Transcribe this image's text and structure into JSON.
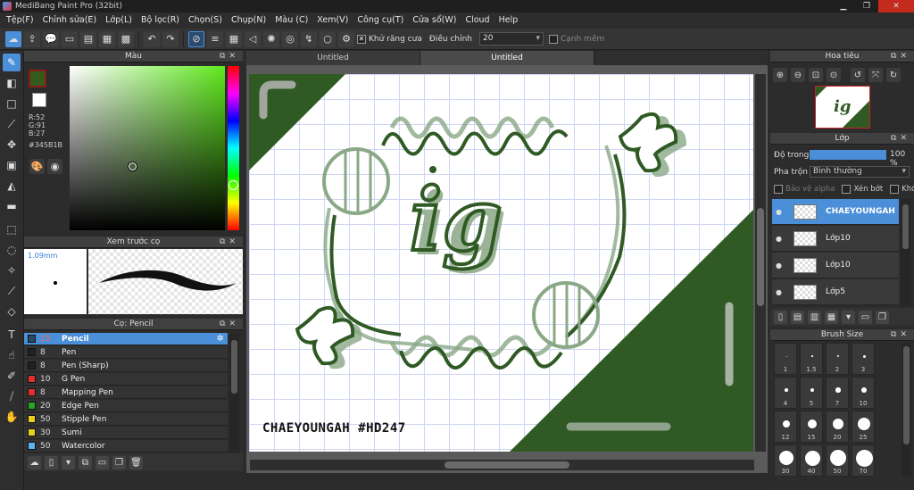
{
  "window": {
    "title": "MediBang Paint Pro (32bit)"
  },
  "menu": [
    "Tệp(F)",
    "Chỉnh sửa(E)",
    "Lớp(L)",
    "Bộ lọc(R)",
    "Chọn(S)",
    "Chụp(N)",
    "Màu (C)",
    "Xem(V)",
    "Công cụ(T)",
    "Cửa sổ(W)",
    "Cloud",
    "Help"
  ],
  "toolbar": {
    "antialias_label": "Khử răng cưa",
    "correction_label": "Điều chỉnh",
    "correction_value": "20",
    "soft_edge_label": "Cạnh mềm"
  },
  "color_panel": {
    "title": "Màu",
    "r": "R:52",
    "g": "G:91",
    "b": "B:27",
    "hex": "#345B1B",
    "foreground": "#345B1B",
    "background": "#FFFFFF"
  },
  "preview_panel": {
    "title": "Xem trước cọ",
    "size": "1.09mm"
  },
  "brush_panel": {
    "title": "Cọ: Pencil",
    "brushes": [
      {
        "size": "15",
        "name": "Pencil",
        "color": "#2b4a66",
        "selected": true
      },
      {
        "size": "8",
        "name": "Pen",
        "color": "#222222"
      },
      {
        "size": "8",
        "name": "Pen (Sharp)",
        "color": "#222222"
      },
      {
        "size": "10",
        "name": "G Pen",
        "color": "#e03030"
      },
      {
        "size": "8",
        "name": "Mapping Pen",
        "color": "#e03030"
      },
      {
        "size": "20",
        "name": "Edge Pen",
        "color": "#2aa52a"
      },
      {
        "size": "50",
        "name": "Stipple Pen",
        "color": "#e8d020"
      },
      {
        "size": "30",
        "name": "Sumi",
        "color": "#e8d020"
      },
      {
        "size": "50",
        "name": "Watercolor",
        "color": "#5ab4f0"
      }
    ]
  },
  "tabs": [
    "Untitled",
    "Untitled"
  ],
  "canvas": {
    "signature": "CHAEYOUNGAH #HD247",
    "logo_text": "ig",
    "accent": "#2f5a24"
  },
  "navigator": {
    "title": "Hoa tiêu"
  },
  "layer_panel": {
    "title": "Lớp",
    "opacity_label": "Độ trong",
    "opacity_value": "100 %",
    "blend_label": "Pha trộn",
    "blend_value": "Bình thường",
    "protect_alpha": "Bảo vệ alpha",
    "clipping": "Xén bớt",
    "lock": "Khóa",
    "layers": [
      {
        "name": "CHAEYOUNGAH",
        "selected": true
      },
      {
        "name": "Lớp10"
      },
      {
        "name": "Lớp10"
      },
      {
        "name": "Lớp5"
      }
    ]
  },
  "brush_size_panel": {
    "title": "Brush Size",
    "sizes": [
      "1",
      "1.5",
      "2",
      "3",
      "4",
      "5",
      "7",
      "10",
      "12",
      "15",
      "20",
      "25",
      "30",
      "40",
      "50",
      "70"
    ]
  }
}
